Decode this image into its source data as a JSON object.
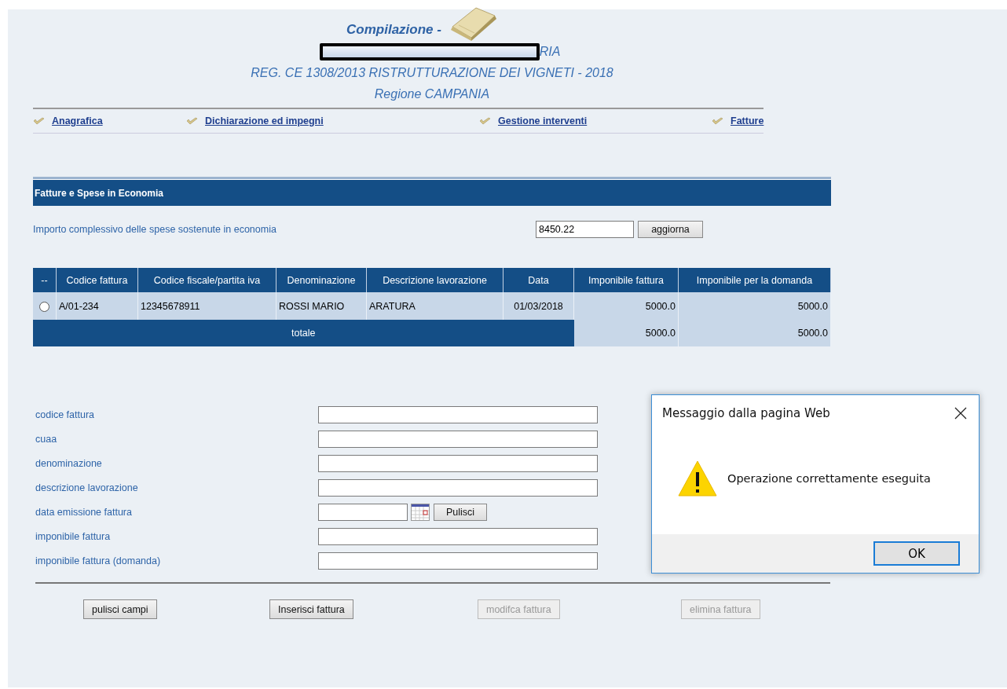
{
  "header": {
    "title": "Compilazione -",
    "redacted_line_tail": "RIA",
    "subtitle": "REG. CE 1308/2013 RISTRUTTURAZIONE DEI VIGNETI - 2018",
    "region": "Regione CAMPANIA"
  },
  "nav": [
    {
      "label": "Anagrafica"
    },
    {
      "label": "Dichiarazione ed impegni"
    },
    {
      "label": "Gestione interventi"
    },
    {
      "label": "Fatture"
    }
  ],
  "section": {
    "title": "Fatture e Spese in Economia"
  },
  "total_expense": {
    "label": "Importo complessivo delle spese sostenute in economia",
    "value": "8450.22",
    "button": "aggiorna"
  },
  "table": {
    "columns": [
      {
        "label": "--",
        "kind": "select"
      },
      {
        "label": "Codice fattura",
        "kind": "text"
      },
      {
        "label": "Codice fiscale/partita iva",
        "kind": "text"
      },
      {
        "label": "Denominazione",
        "kind": "text"
      },
      {
        "label": "Descrizione lavorazione",
        "kind": "text"
      },
      {
        "label": "Data",
        "kind": "date"
      },
      {
        "label": "Imponibile fattura",
        "kind": "amount"
      },
      {
        "label": "Imponibile per la domanda",
        "kind": "amount"
      }
    ],
    "rows": [
      {
        "selected": false,
        "cells": [
          "",
          "A/01-234",
          "12345678911",
          "ROSSI MARIO",
          "ARATURA",
          "01/03/2018",
          "5000.0",
          "5000.0"
        ]
      }
    ],
    "total": {
      "label": "totale",
      "cells": [
        "5000.0",
        "5000.0"
      ]
    }
  },
  "form": {
    "fields": [
      {
        "label": "codice fattura",
        "kind": "text"
      },
      {
        "label": "cuaa",
        "kind": "text"
      },
      {
        "label": "denominazione",
        "kind": "text"
      },
      {
        "label": "descrizione lavorazione",
        "kind": "text"
      },
      {
        "label": "data emissione fattura",
        "kind": "date",
        "button": "Pulisci"
      },
      {
        "label": "imponibile fattura",
        "kind": "text"
      },
      {
        "label": "imponibile fattura (domanda)",
        "kind": "text"
      }
    ]
  },
  "actions": [
    {
      "label": "pulisci campi",
      "disabled": false
    },
    {
      "label": "Inserisci fattura",
      "disabled": false
    },
    {
      "label": "modifca fattura",
      "disabled": true
    },
    {
      "label": "elimina fattura",
      "disabled": true
    }
  ],
  "dialog": {
    "title": "Messaggio dalla pagina Web",
    "message": "Operazione correttamente eseguita",
    "button": "OK"
  }
}
